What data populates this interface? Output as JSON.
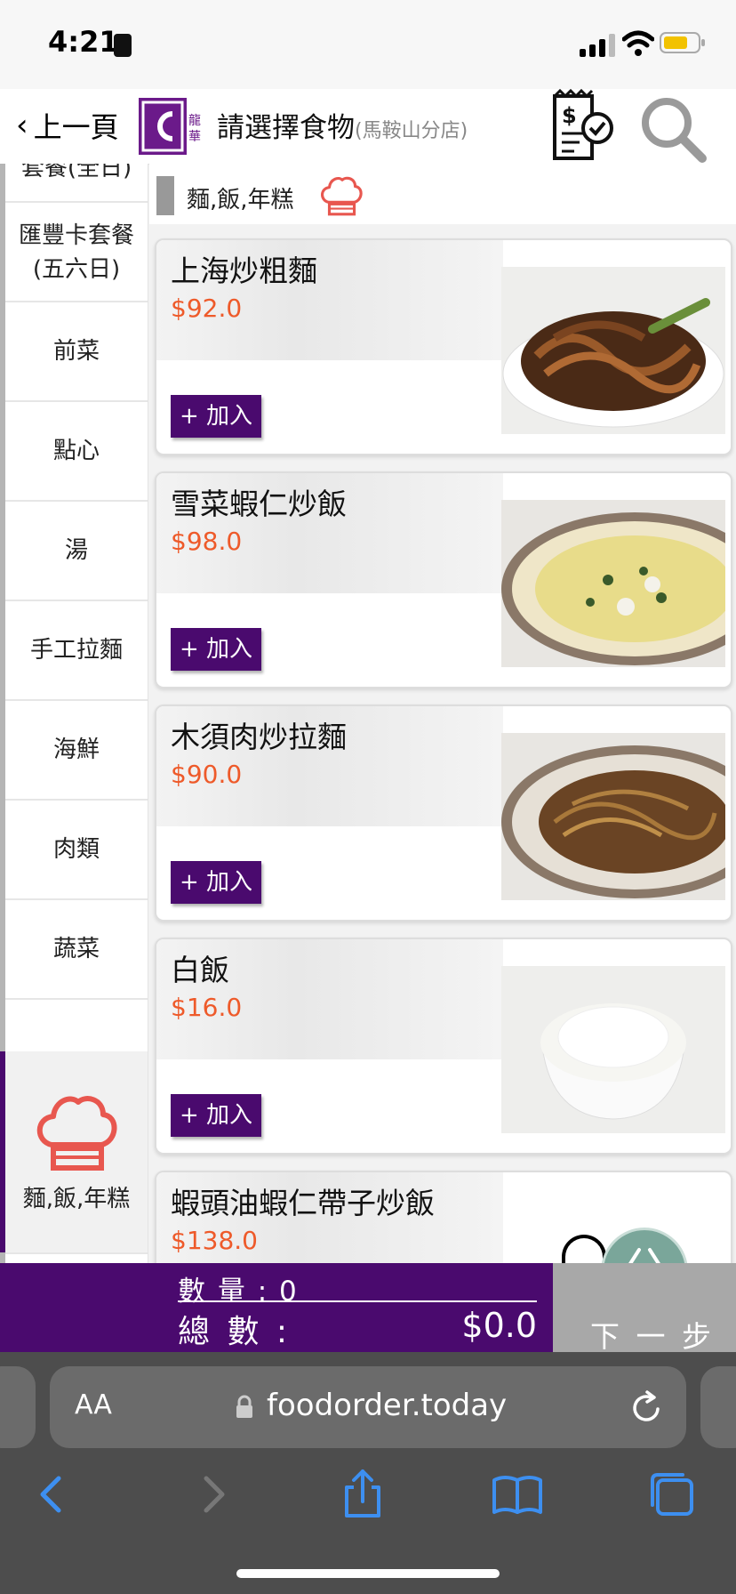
{
  "status": {
    "time": "4:21"
  },
  "header": {
    "back_label": "上一頁",
    "title": "請選擇食物",
    "subtitle": "(馬鞍山分店)",
    "logo_text": "龍華"
  },
  "sidebar": {
    "items": [
      {
        "label": "套餐(全日)"
      },
      {
        "label": "匯豐卡套餐(五六日)"
      },
      {
        "label": "前菜"
      },
      {
        "label": "點心"
      },
      {
        "label": "湯"
      },
      {
        "label": "手工拉麵"
      },
      {
        "label": "海鮮"
      },
      {
        "label": "肉類"
      },
      {
        "label": "蔬菜"
      },
      {
        "label": "麵,飯,年糕",
        "active": true
      }
    ]
  },
  "category": {
    "label": "麵,飯,年糕"
  },
  "items": [
    {
      "name": "上海炒粗麵",
      "price": "$92.0",
      "add_label": "+ 加入"
    },
    {
      "name": "雪菜蝦仁炒飯",
      "price": "$98.0",
      "add_label": "+ 加入"
    },
    {
      "name": "木須肉炒拉麵",
      "price": "$90.0",
      "add_label": "+ 加入"
    },
    {
      "name": "白飯",
      "price": "$16.0",
      "add_label": "+ 加入"
    },
    {
      "name": "蝦頭油蝦仁帶子炒飯",
      "price": "$138.0",
      "add_label": "+ 加入"
    }
  ],
  "order": {
    "quantity_text": "數 量 :  0",
    "total_label": "總 數 :",
    "total_value": "$0.0",
    "next_label": "下 一 步"
  },
  "browser": {
    "aa_label": "AA",
    "url": "foodorder.today"
  },
  "colors": {
    "brand_purple": "#4a0a6e",
    "price_orange": "#ee5a2a",
    "chef_red": "#e8574f"
  }
}
